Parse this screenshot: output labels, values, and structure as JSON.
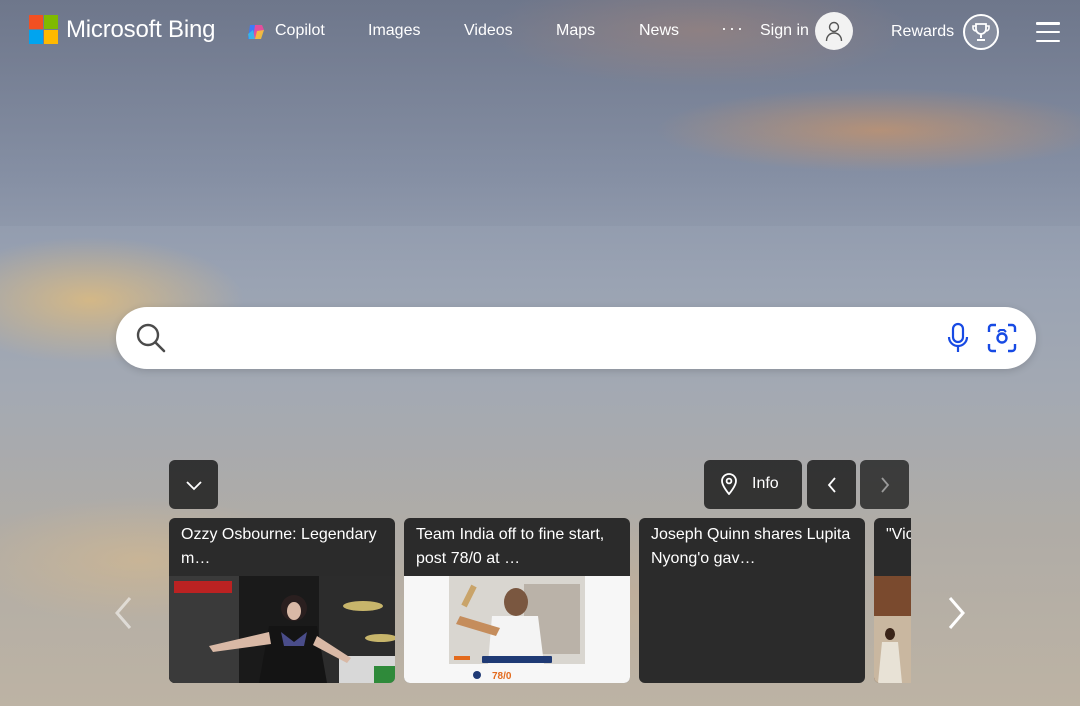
{
  "header": {
    "logo_text": "Microsoft Bing",
    "nav": [
      "Copilot",
      "Images",
      "Videos",
      "Maps",
      "News"
    ],
    "more": "···",
    "sign_in": "Sign in",
    "rewards": "Rewards"
  },
  "search": {
    "placeholder": "",
    "value": ""
  },
  "controls": {
    "info_label": "Info"
  },
  "news": [
    {
      "title": "Ozzy Osbourne: Legendary m…"
    },
    {
      "title": "Team India off to fine start, post 78/0 at …"
    },
    {
      "title": "Joseph Quinn shares Lupita Nyong'o gav…"
    },
    {
      "title": "\"Vic… resi…"
    }
  ],
  "news_image_text": {
    "scoreboard": "78/0"
  },
  "colors": {
    "panel": "#282828",
    "accent_blue": "#174ae4"
  }
}
